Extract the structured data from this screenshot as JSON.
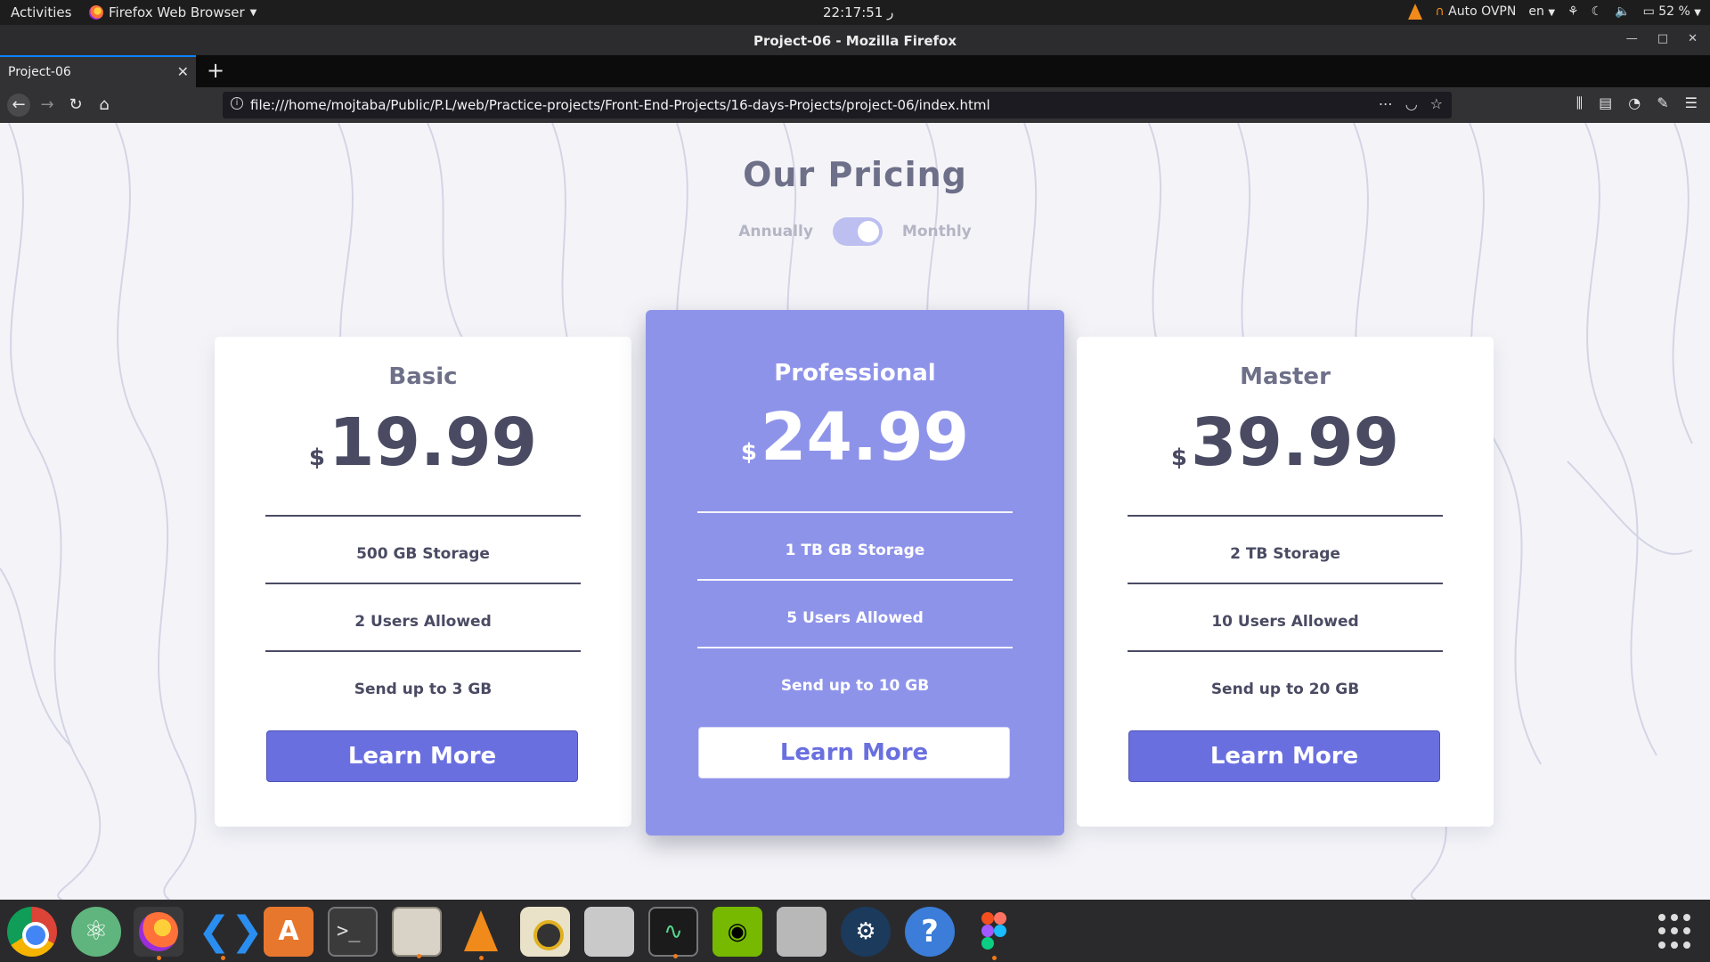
{
  "topbar": {
    "activities": "Activities",
    "app_name": "Firefox Web Browser",
    "clock": "22:17:51 ر",
    "vpn": "Auto OVPN",
    "lang": "en",
    "battery": "52 %"
  },
  "window": {
    "title": "Project-06 - Mozilla Firefox"
  },
  "tabs": [
    {
      "label": "Project-06"
    }
  ],
  "urlbar": {
    "url": "file:///home/mojtaba/Public/P.L/web/Practice-projects/Front-End-Projects/16-days-Projects/project-06/index.html"
  },
  "page": {
    "title": "Our Pricing",
    "toggle": {
      "left": "Annually",
      "right": "Monthly",
      "selected": "Monthly"
    },
    "plans": [
      {
        "name": "Basic",
        "currency": "$",
        "price": "19.99",
        "features": [
          "500 GB Storage",
          "2 Users Allowed",
          "Send up to 3 GB"
        ],
        "button": "Learn More"
      },
      {
        "name": "Professional",
        "currency": "$",
        "price": "24.99",
        "features": [
          "1 TB GB Storage",
          "5 Users Allowed",
          "Send up to 10 GB"
        ],
        "button": "Learn More"
      },
      {
        "name": "Master",
        "currency": "$",
        "price": "39.99",
        "features": [
          "2 TB Storage",
          "10 Users Allowed",
          "Send up to 20 GB"
        ],
        "button": "Learn More"
      }
    ]
  },
  "colors": {
    "accent": "#6a6fe0",
    "featured_card": "#8e93ea",
    "title": "#6e7089",
    "text_dark": "#4a4b63",
    "background": "#f4f4f8"
  },
  "dock": {
    "apps": [
      "chrome-icon",
      "atom-icon",
      "firefox-icon",
      "vscode-icon",
      "software-center-icon",
      "terminal-icon",
      "files-icon",
      "vlc-icon",
      "rhythmbox-icon",
      "mixer-icon",
      "system-monitor-icon",
      "nvidia-icon",
      "transmission-icon",
      "steam-icon",
      "help-icon",
      "figma-icon"
    ]
  }
}
